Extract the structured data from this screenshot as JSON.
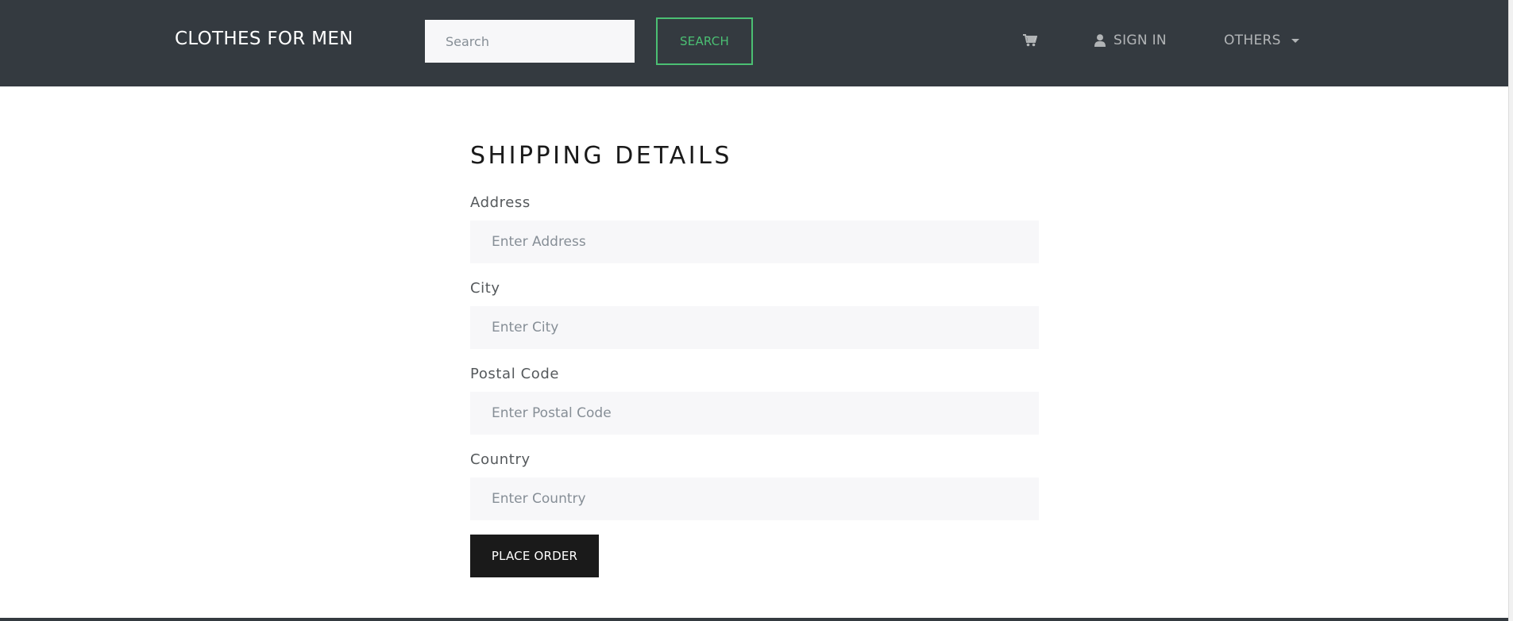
{
  "header": {
    "brand": "CLOTHES FOR MEN",
    "search": {
      "placeholder": "Search",
      "value": "",
      "button_label": "SEARCH"
    },
    "nav": {
      "cart_icon": "shopping-cart-icon",
      "signin_icon": "user-icon",
      "signin_label": "SIGN IN",
      "others_label": "OTHERS"
    },
    "colors": {
      "background": "#343a40",
      "accent": "#4bbf73"
    }
  },
  "form": {
    "title": "SHIPPING DETAILS",
    "fields": [
      {
        "label": "Address",
        "placeholder": "Enter Address",
        "value": ""
      },
      {
        "label": "City",
        "placeholder": "Enter City",
        "value": ""
      },
      {
        "label": "Postal Code",
        "placeholder": "Enter Postal Code",
        "value": ""
      },
      {
        "label": "Country",
        "placeholder": "Enter Country",
        "value": ""
      }
    ],
    "submit_label": "PLACE ORDER",
    "colors": {
      "input_background": "#f7f7f9",
      "button_background": "#1a1a1a"
    }
  }
}
